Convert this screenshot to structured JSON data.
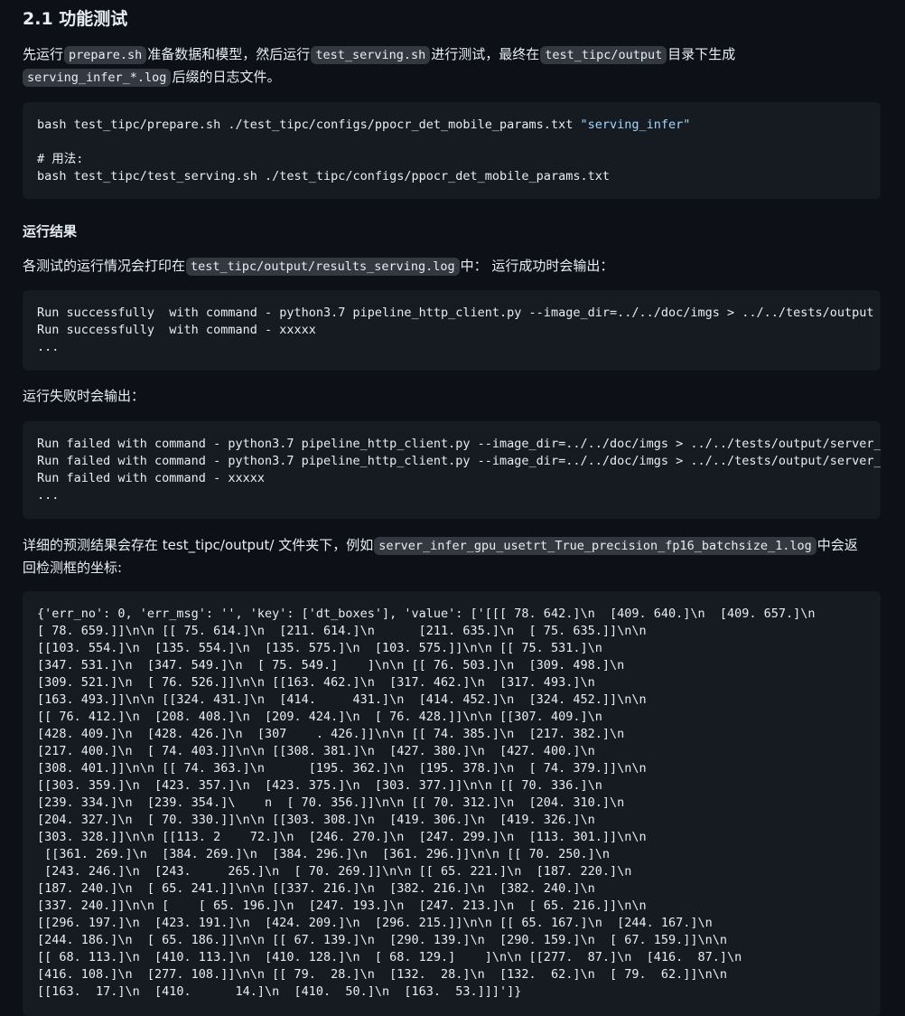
{
  "section": {
    "heading": "2.1 功能测试"
  },
  "intro": {
    "t1": "先运行",
    "c1": "prepare.sh",
    "t2": "准备数据和模型，然后运行",
    "c2": "test_serving.sh",
    "t3": "进行测试，最终在",
    "c3": "test_tipc/output",
    "t4": "目录下生成",
    "c4": "serving_infer_*.log",
    "t5": "后缀的日志文件。"
  },
  "cmd_block": {
    "line1_cmd": "bash test_tipc/prepare.sh ./test_tipc/configs/ppocr_det_mobile_params.txt ",
    "line1_arg": "\"serving_infer\"",
    "comment": "# 用法:",
    "line3": "bash test_tipc/test_serving.sh ./test_tipc/configs/ppocr_det_mobile_params.txt"
  },
  "results": {
    "title": "运行结果",
    "t1": "各测试的运行情况会打印在",
    "c1": "test_tipc/output/results_serving.log",
    "t2": "中： 运行成功时会输出："
  },
  "success_block": {
    "lines": [
      "Run successfully  with command - python3.7 pipeline_http_client.py --image_dir=../../doc/imgs > ../../tests/output",
      "Run successfully  with command - xxxxx",
      "..."
    ]
  },
  "fail_intro": "运行失败时会输出：",
  "fail_block": {
    "lines": [
      "Run failed with command - python3.7 pipeline_http_client.py --image_dir=../../doc/imgs > ../../tests/output/server_",
      "Run failed with command - python3.7 pipeline_http_client.py --image_dir=../../doc/imgs > ../../tests/output/server_",
      "Run failed with command - xxxxx",
      "..."
    ]
  },
  "detail": {
    "t1": "详细的预测结果会存在 test_tipc/output/ 文件夹下，例如",
    "c1": "server_infer_gpu_usetrt_True_precision_fp16_batchsize_1.log",
    "t2": "中会返",
    "t3": "回检测框的坐标:"
  },
  "output_block": {
    "lines": [
      "{'err_no': 0, 'err_msg': '', 'key': ['dt_boxes'], 'value': ['[[[ 78. 642.]\\n  [409. 640.]\\n  [409. 657.]\\n",
      "[ 78. 659.]]\\n\\n [[ 75. 614.]\\n  [211. 614.]\\n      [211. 635.]\\n  [ 75. 635.]]\\n\\n",
      "[[103. 554.]\\n  [135. 554.]\\n  [135. 575.]\\n  [103. 575.]]\\n\\n [[ 75. 531.]\\n",
      "[347. 531.]\\n  [347. 549.]\\n  [ 75. 549.]    ]\\n\\n [[ 76. 503.]\\n  [309. 498.]\\n",
      "[309. 521.]\\n  [ 76. 526.]]\\n\\n [[163. 462.]\\n  [317. 462.]\\n  [317. 493.]\\n",
      "[163. 493.]]\\n\\n [[324. 431.]\\n  [414.     431.]\\n  [414. 452.]\\n  [324. 452.]]\\n\\n",
      "[[ 76. 412.]\\n  [208. 408.]\\n  [209. 424.]\\n  [ 76. 428.]]\\n\\n [[307. 409.]\\n",
      "[428. 409.]\\n  [428. 426.]\\n  [307    . 426.]]\\n\\n [[ 74. 385.]\\n  [217. 382.]\\n",
      "[217. 400.]\\n  [ 74. 403.]]\\n\\n [[308. 381.]\\n  [427. 380.]\\n  [427. 400.]\\n",
      "[308. 401.]]\\n\\n [[ 74. 363.]\\n      [195. 362.]\\n  [195. 378.]\\n  [ 74. 379.]]\\n\\n",
      "[[303. 359.]\\n  [423. 357.]\\n  [423. 375.]\\n  [303. 377.]]\\n\\n [[ 70. 336.]\\n",
      "[239. 334.]\\n  [239. 354.]\\    n  [ 70. 356.]]\\n\\n [[ 70. 312.]\\n  [204. 310.]\\n",
      "[204. 327.]\\n  [ 70. 330.]]\\n\\n [[303. 308.]\\n  [419. 306.]\\n  [419. 326.]\\n",
      "[303. 328.]]\\n\\n [[113. 2    72.]\\n  [246. 270.]\\n  [247. 299.]\\n  [113. 301.]]\\n\\n",
      " [[361. 269.]\\n  [384. 269.]\\n  [384. 296.]\\n  [361. 296.]]\\n\\n [[ 70. 250.]\\n",
      " [243. 246.]\\n  [243.     265.]\\n  [ 70. 269.]]\\n\\n [[ 65. 221.]\\n  [187. 220.]\\n",
      "[187. 240.]\\n  [ 65. 241.]]\\n\\n [[337. 216.]\\n  [382. 216.]\\n  [382. 240.]\\n",
      "[337. 240.]]\\n\\n [    [ 65. 196.]\\n  [247. 193.]\\n  [247. 213.]\\n  [ 65. 216.]]\\n\\n",
      "[[296. 197.]\\n  [423. 191.]\\n  [424. 209.]\\n  [296. 215.]]\\n\\n [[ 65. 167.]\\n  [244. 167.]\\n",
      "[244. 186.]\\n  [ 65. 186.]]\\n\\n [[ 67. 139.]\\n  [290. 139.]\\n  [290. 159.]\\n  [ 67. 159.]]\\n\\n",
      "[[ 68. 113.]\\n  [410. 113.]\\n  [410. 128.]\\n  [ 68. 129.]    ]\\n\\n [[277.  87.]\\n  [416.  87.]\\n",
      "[416. 108.]\\n  [277. 108.]]\\n\\n [[ 79.  28.]\\n  [132.  28.]\\n  [132.  62.]\\n  [ 79.  62.]]\\n\\n",
      "[[163.  17.]\\n  [410.      14.]\\n  [410.  50.]\\n  [163.  53.]]]']}"
    ]
  },
  "colors": {
    "background": "#0d1117",
    "code_background": "#161b22",
    "inline_code_background": "#343941",
    "text": "#e6edf3",
    "string": "#a5d6ff",
    "comment": "#8b949e"
  }
}
